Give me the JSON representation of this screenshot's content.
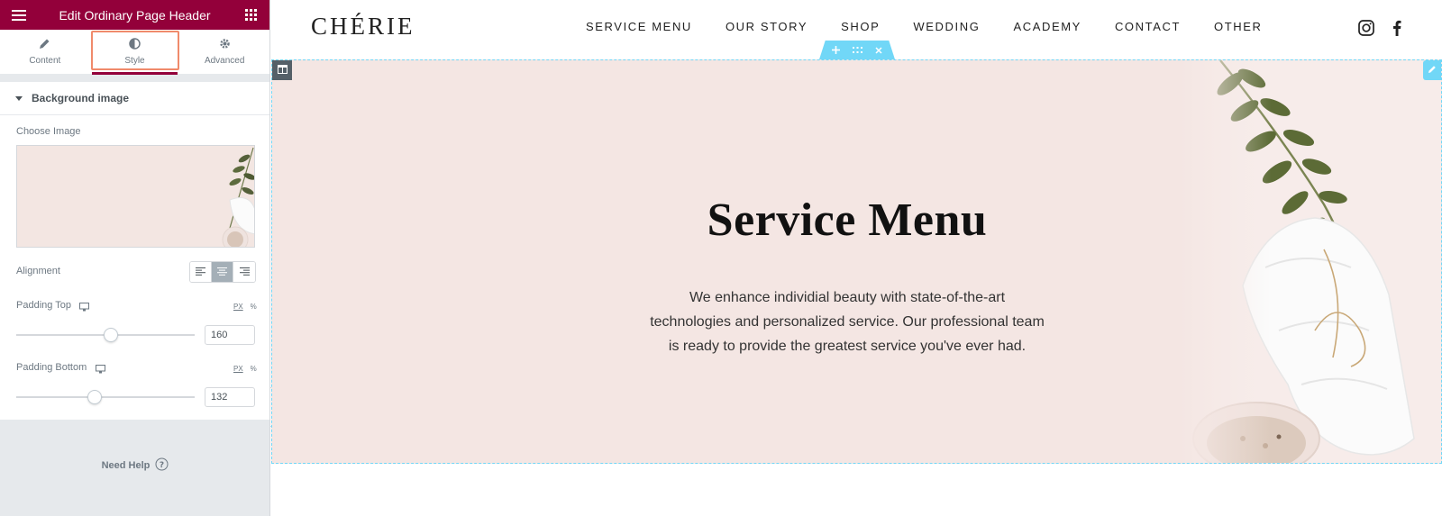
{
  "panel": {
    "title": "Edit Ordinary Page Header",
    "tabs": [
      {
        "label": "Content",
        "icon": "pencil-icon"
      },
      {
        "label": "Style",
        "icon": "contrast-icon",
        "active": true
      },
      {
        "label": "Advanced",
        "icon": "gear-icon"
      }
    ],
    "section_title": "Background image",
    "choose_image_label": "Choose Image",
    "alignment_label": "Alignment",
    "alignment_selected": "center",
    "padding_top": {
      "label": "Padding Top",
      "value": "160",
      "unit": "PX",
      "alt_unit": "%",
      "slider_fraction": 0.53
    },
    "padding_bottom": {
      "label": "Padding Bottom",
      "value": "132",
      "unit": "PX",
      "alt_unit": "%",
      "slider_fraction": 0.44
    },
    "need_help": "Need Help"
  },
  "site": {
    "logo": "CHÉRIE",
    "nav": [
      "SERVICE MENU",
      "OUR STORY",
      "SHOP",
      "WEDDING",
      "ACADEMY",
      "CONTACT",
      "OTHER"
    ],
    "social": [
      "instagram-icon",
      "facebook-icon"
    ],
    "hero": {
      "title": "Service Menu",
      "text": "We enhance individial beauty with state-of-the-art technologies and personalized service. Our professional team is ready to provide the greatest service you've ever had."
    }
  },
  "colors": {
    "panel_accent": "#93003a",
    "hero_background": "#f4e6e3",
    "editor_handle": "#71d7f7",
    "tab_highlight": "#f08a6b"
  }
}
